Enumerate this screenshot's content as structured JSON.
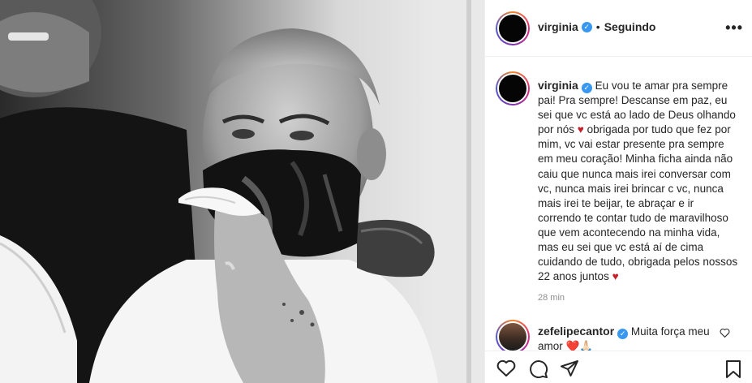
{
  "post": {
    "username": "virginia",
    "separator": "•",
    "follow_status": "Seguindo",
    "more_label": "•••"
  },
  "caption": {
    "username": "virginia",
    "text_before_heart_1": "Eu vou te amar pra sempre pai! Pra sempre! Descanse em paz, eu sei que vc está ao lado de Deus olhando por nós",
    "text_after_heart_1": "obrigada por tudo que fez por mim, vc vai estar presente pra sempre em meu coração! Minha ficha ainda não caiu que nunca mais irei conversar com vc, nunca mais irei brincar c vc, nunca mais irei te beijar, te abraçar e ir correndo te contar tudo de maravilhoso que vem acontecendo na minha vida, mas eu sei que vc está aí de cima cuidando de tudo, obrigada pelos nossos 22 anos juntos",
    "heart": "♥",
    "time": "28 min"
  },
  "comments": [
    {
      "username": "zefelipecantor",
      "text": "Muita força meu amor",
      "emoji_tail": "❤️🙏🏻"
    }
  ],
  "icons": {
    "like": "heart-outline-icon",
    "comment": "comment-icon",
    "share": "paper-plane-icon",
    "save": "bookmark-icon",
    "verified": "verified-badge-icon",
    "more": "more-options-icon"
  },
  "colors": {
    "verified": "#3897f0",
    "heart": "#c4202a",
    "secondary_text": "#8e8e8e",
    "border": "#efefef"
  }
}
